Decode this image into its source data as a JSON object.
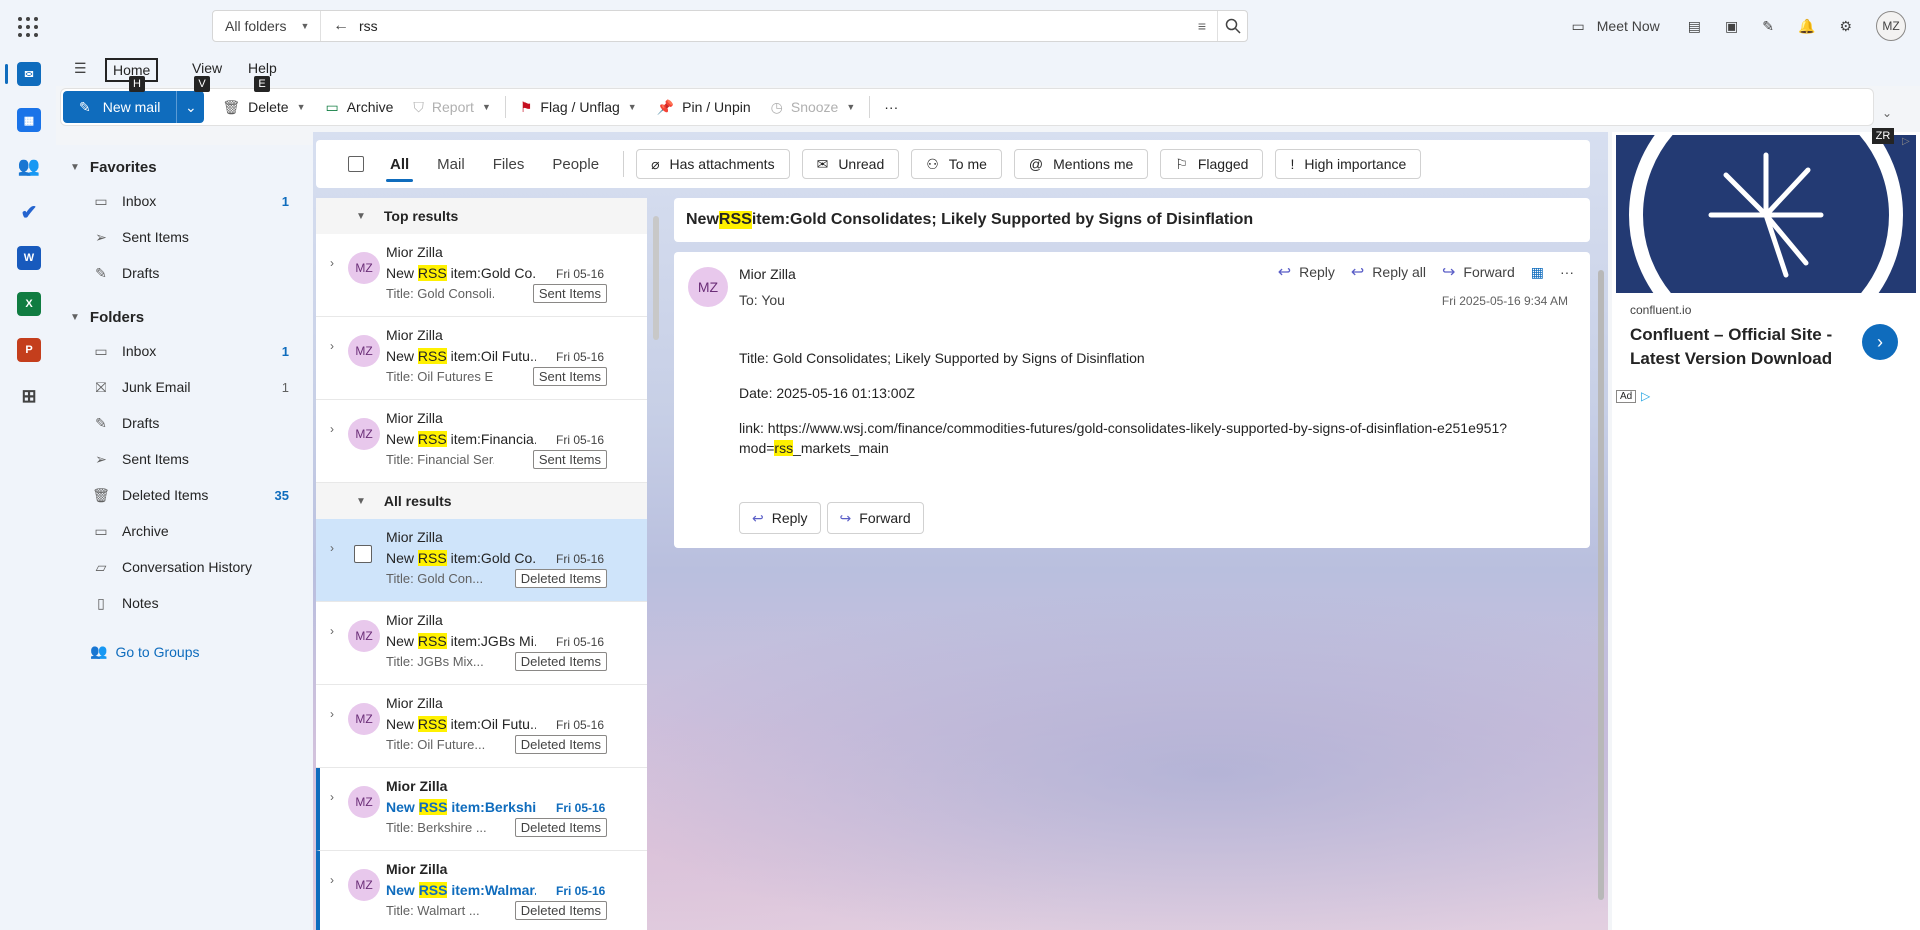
{
  "search": {
    "scope": "All folders",
    "query": "rss"
  },
  "topbar": {
    "meet_now": "Meet Now",
    "avatar_initials": "MZ"
  },
  "ribbon_tabs": [
    {
      "label": "Home",
      "keytip": "H"
    },
    {
      "label": "View",
      "keytip": "V"
    },
    {
      "label": "Help",
      "keytip": "E"
    }
  ],
  "ribbon": {
    "new_mail": "New mail",
    "delete": "Delete",
    "archive": "Archive",
    "report": "Report",
    "flag": "Flag / Unflag",
    "pin": "Pin / Unpin",
    "snooze": "Snooze",
    "more": "···"
  },
  "folders": {
    "favorites_title": "Favorites",
    "favorites": [
      {
        "name": "Inbox",
        "count": "1",
        "icon": "inbox-icon"
      },
      {
        "name": "Sent Items",
        "count": "",
        "icon": "send-icon"
      },
      {
        "name": "Drafts",
        "count": "",
        "icon": "draft-icon"
      }
    ],
    "folders_title": "Folders",
    "list": [
      {
        "name": "Inbox",
        "count": "1",
        "icon": "inbox-icon"
      },
      {
        "name": "Junk Email",
        "count": "1",
        "icon": "junk-icon"
      },
      {
        "name": "Drafts",
        "count": "",
        "icon": "draft-icon"
      },
      {
        "name": "Sent Items",
        "count": "",
        "icon": "send-icon"
      },
      {
        "name": "Deleted Items",
        "count": "35",
        "icon": "trash-icon"
      },
      {
        "name": "Archive",
        "count": "",
        "icon": "archive-icon"
      },
      {
        "name": "Conversation History",
        "count": "",
        "icon": "folder-icon"
      },
      {
        "name": "Notes",
        "count": "",
        "icon": "notes-icon"
      }
    ],
    "go_to_groups": "Go to Groups"
  },
  "filters": {
    "tabs": [
      "All",
      "Mail",
      "Files",
      "People"
    ],
    "chips": [
      "Has attachments",
      "Unread",
      "To me",
      "Mentions me",
      "Flagged",
      "High importance"
    ]
  },
  "results": {
    "top_title": "Top results",
    "all_title": "All results",
    "top": [
      {
        "sender": "Mior Zilla",
        "pre": "New ",
        "hl": "RSS",
        "subj": " item:Gold Co...",
        "date": "Fri 05-16",
        "preview": "Title: Gold Consoli...",
        "tag": "Sent Items"
      },
      {
        "sender": "Mior Zilla",
        "pre": "New ",
        "hl": "RSS",
        "subj": " item:Oil Futu...",
        "date": "Fri 05-16",
        "preview": "Title: Oil Futures E...",
        "tag": "Sent Items"
      },
      {
        "sender": "Mior Zilla",
        "pre": "New ",
        "hl": "RSS",
        "subj": " item:Financia...",
        "date": "Fri 05-16",
        "preview": "Title: Financial Ser...",
        "tag": "Sent Items"
      }
    ],
    "all": [
      {
        "sender": "Mior Zilla",
        "pre": "New ",
        "hl": "RSS",
        "subj": " item:Gold Co...",
        "date": "Fri 05-16",
        "preview": "Title: Gold Con...",
        "tag": "Deleted Items"
      },
      {
        "sender": "Mior Zilla",
        "pre": "New ",
        "hl": "RSS",
        "subj": " item:JGBs Mi...",
        "date": "Fri 05-16",
        "preview": "Title: JGBs Mix...",
        "tag": "Deleted Items"
      },
      {
        "sender": "Mior Zilla",
        "pre": "New ",
        "hl": "RSS",
        "subj": " item:Oil Futu...",
        "date": "Fri 05-16",
        "preview": "Title: Oil Future...",
        "tag": "Deleted Items"
      },
      {
        "sender": "Mior Zilla",
        "pre": "New ",
        "hl": "RSS",
        "subj": " item:Berkshi...",
        "date": "Fri 05-16",
        "preview": "Title: Berkshire ...",
        "tag": "Deleted Items"
      },
      {
        "sender": "Mior Zilla",
        "pre": "New ",
        "hl": "RSS",
        "subj": " item:Walmar...",
        "date": "Fri 05-16",
        "preview": "Title: Walmart ...",
        "tag": "Deleted Items"
      }
    ]
  },
  "reading": {
    "subject_pre": "New ",
    "subject_hl": "RSS",
    "subject_post": " item:Gold Consolidates; Likely Supported by Signs of Disinflation",
    "sender": "Mior Zilla",
    "to": "To:  You",
    "initials": "MZ",
    "datetime": "Fri 2025-05-16 9:34 AM",
    "reply": "Reply",
    "reply_all": "Reply all",
    "forward": "Forward",
    "body_title": "Title: Gold Consolidates; Likely Supported by Signs of Disinflation",
    "body_date": "Date: 2025-05-16 01:13:00Z",
    "body_link_pre": "link: https://www.wsj.com/finance/commodities-futures/gold-consolidates-likely-supported-by-signs-of-disinflation-e251e951?mod=",
    "body_link_hl": "rss",
    "body_link_post": "_markets_main",
    "btn_reply": "Reply",
    "btn_forward": "Forward"
  },
  "ad": {
    "keytip": "ZR",
    "domain": "confluent.io",
    "title": "Confluent – Official Site - Latest Version Download",
    "badge": "Ad"
  },
  "colors": {
    "accent": "#0f6cbd",
    "highlight": "#fff100",
    "avatar_bg": "#e8c8ec"
  }
}
